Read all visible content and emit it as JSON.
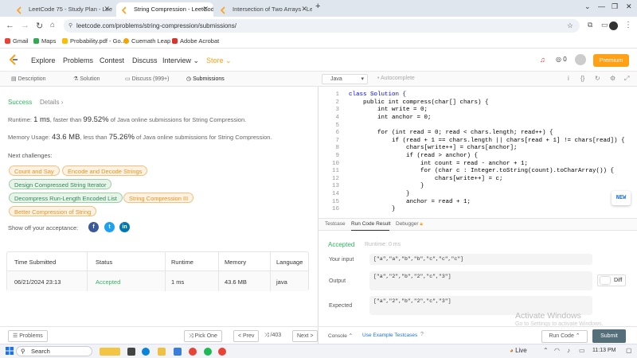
{
  "browser": {
    "tabs": [
      {
        "label": "LeetCode 75 - Study Plan - Lee",
        "active": false
      },
      {
        "label": "String Compression - LeetCode",
        "active": true
      },
      {
        "label": "Intersection of Two Arrays - Lee",
        "active": false
      }
    ],
    "new_tab": "+",
    "url": "leetcode.com/problems/string-compression/submissions/",
    "bookmarks": [
      "Gmail",
      "Maps",
      "Probability.pdf - Go...",
      "Cuemath Leap",
      "Adobe Acrobat"
    ]
  },
  "lc_nav": {
    "items": [
      "Explore",
      "Problems",
      "Contest",
      "Discuss",
      "Interview",
      "Store"
    ],
    "notif_count": "0",
    "premium": "Premium"
  },
  "left": {
    "tabs": [
      "Description",
      "Solution",
      "Discuss (999+)",
      "Submissions"
    ],
    "success": "Success",
    "details": "Details",
    "runtime_label": "Runtime: ",
    "runtime_value": "1 ms",
    "runtime_text1": ", faster than ",
    "runtime_pct": "99.52%",
    "runtime_text2": " of Java online submissions for String Compression.",
    "memory_label": "Memory Usage: ",
    "memory_value": "43.6 MB",
    "memory_text1": ", less than ",
    "memory_pct": "75.26%",
    "memory_text2": " of Java online submissions for String Compression.",
    "next_challenges": "Next challenges:",
    "challenges": [
      {
        "label": "Count and Say",
        "level": "medium"
      },
      {
        "label": "Encode and Decode Strings",
        "level": "medium"
      },
      {
        "label": "Design Compressed String Iterator",
        "level": "easy"
      },
      {
        "label": "Decompress Run-Length Encoded List",
        "level": "easy"
      },
      {
        "label": "String Compression III",
        "level": "medium"
      },
      {
        "label": "Better Compression of String",
        "level": "medium"
      }
    ],
    "show_off": "Show off your acceptance:",
    "table": {
      "headers": [
        "Time Submitted",
        "Status",
        "Runtime",
        "Memory",
        "Language"
      ],
      "row": [
        "06/21/2024 23:13",
        "Accepted",
        "1 ms",
        "43.6 MB",
        "java"
      ]
    },
    "footer": {
      "problems": "Problems",
      "pick_one": "Pick One",
      "prev": "< Prev",
      "page": "/403",
      "next": "Next >"
    }
  },
  "editor": {
    "language": "Java",
    "autocomplete": "Autocomplete",
    "line_numbers": [
      "1",
      "2",
      "3",
      "4",
      "5",
      "6",
      "7",
      "8",
      "9",
      "10",
      "11",
      "12",
      "13",
      "14",
      "15",
      "16"
    ],
    "code": [
      "class Solution {",
      "    public int compress(char[] chars) {",
      "        int write = 0;",
      "        int anchor = 0;",
      "",
      "        for (int read = 0; read < chars.length; read++) {",
      "            if (read + 1 == chars.length || chars[read + 1] != chars[read]) {",
      "                chars[write++] = chars[anchor];",
      "                if (read > anchor) {",
      "                    int count = read - anchor + 1;",
      "                    for (char c : Integer.toString(count).toCharArray()) {",
      "                        chars[write++] = c;",
      "                    }",
      "                }",
      "                anchor = read + 1;",
      "            }"
    ],
    "new_badge": "NEW"
  },
  "result": {
    "tabs": [
      "Testcase",
      "Run Code Result",
      "Debugger"
    ],
    "status": "Accepted",
    "runtime": "Runtime: 0 ms",
    "input_label": "Your input",
    "input": "[\"a\",\"a\",\"b\",\"b\",\"c\",\"c\",\"c\"]",
    "output_label": "Output",
    "output": "[\"a\",\"2\",\"b\",\"2\",\"c\",\"3\"]",
    "diff": "Diff",
    "expected_label": "Expected",
    "expected": "[\"a\",\"2\",\"b\",\"2\",\"c\",\"3\"]",
    "watermark1": "Activate Windows",
    "watermark2": "Go to Settings to activate Windows.",
    "console": "Console",
    "use_example": "Use Example Testcases",
    "run_code": "Run Code",
    "submit": "Submit"
  },
  "taskbar": {
    "search": "Search",
    "live": "Live",
    "time": "11:13 PM"
  },
  "colors": {
    "accent": "#ffa116",
    "success": "#2db55d",
    "medium_tag": "#e6951c",
    "submit_btn": "#546e7a"
  }
}
